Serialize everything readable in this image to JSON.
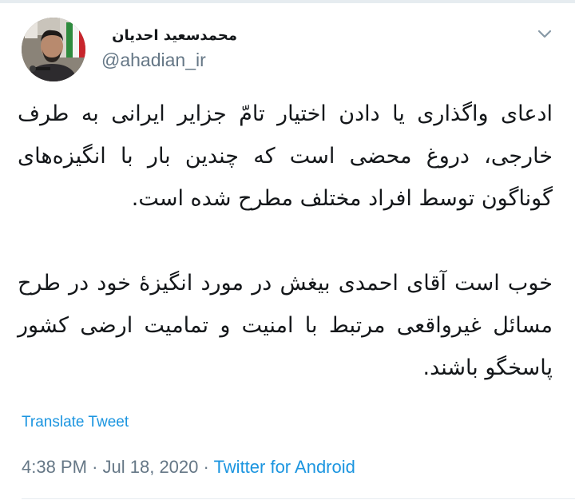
{
  "author": {
    "display_name": "محمدسعید احدیان",
    "handle": "@ahadian_ir",
    "avatar": "profile-photo"
  },
  "menu_icon": "chevron-down-icon",
  "tweet": {
    "paragraphs": [
      "ادعای واگذاری یا دادن اختیار تامّ جزایر ایرانی به طرف خارجی، دروغ محضی است که چندین بار با انگیزه‌های گوناگون توسط افراد مختلف مطرح شده است.",
      "خوب است آقای احمدی بیغش در مورد انگیزۀ خود در طرح مسائل غیرواقعی مرتبط با امنیت و تمامیت ارضی کشور پاسخگو باشند."
    ]
  },
  "translate_label": "Translate Tweet",
  "meta": {
    "time": "4:38 PM",
    "separator": "·",
    "date": "Jul 18, 2020",
    "source": "Twitter for Android"
  },
  "colors": {
    "link": "#1b95e0",
    "secondary_text": "#657786",
    "divider": "#e6ecf0"
  }
}
